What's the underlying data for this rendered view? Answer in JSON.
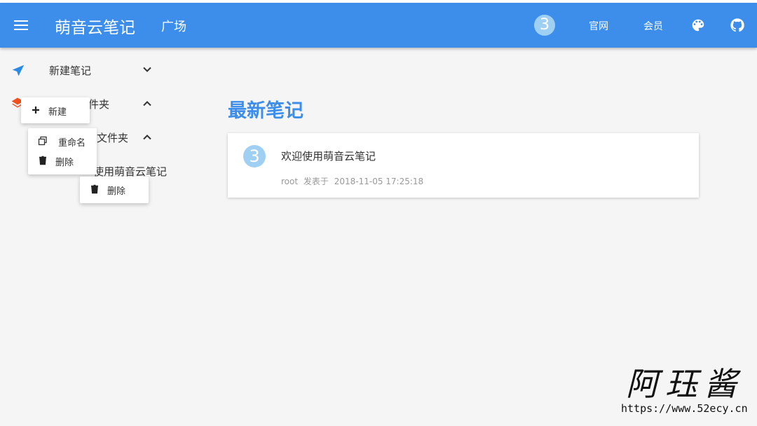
{
  "header": {
    "app_title": "萌音云笔记",
    "nav_square": "广场",
    "avatar_glyph": "3",
    "nav_official": "官网",
    "nav_member": "会员",
    "icons": [
      "menu-icon",
      "palette-icon",
      "github-icon"
    ]
  },
  "sidebar": {
    "new_note": "新建笔记",
    "folder_1": "件夹",
    "folder_2": "文件夹",
    "note_item": "使用萌音云笔记"
  },
  "popups": {
    "new": "新建",
    "rename": "重命名",
    "delete_1": "删除",
    "delete_2": "删除"
  },
  "main": {
    "section_title": "最新笔记",
    "note": {
      "avatar_glyph": "3",
      "title": "欢迎使用萌音云笔记",
      "author": "root",
      "published_label": "发表于",
      "datetime": "2018-11-05 17:25:18"
    }
  },
  "watermark": {
    "signature": "阿珏酱",
    "url": "https://www.52ecy.cn"
  },
  "colors": {
    "primary": "#3d8eea",
    "avatar": "#9fd0f3",
    "background": "#f5f5f5",
    "layers_icon": "#f4511e"
  }
}
